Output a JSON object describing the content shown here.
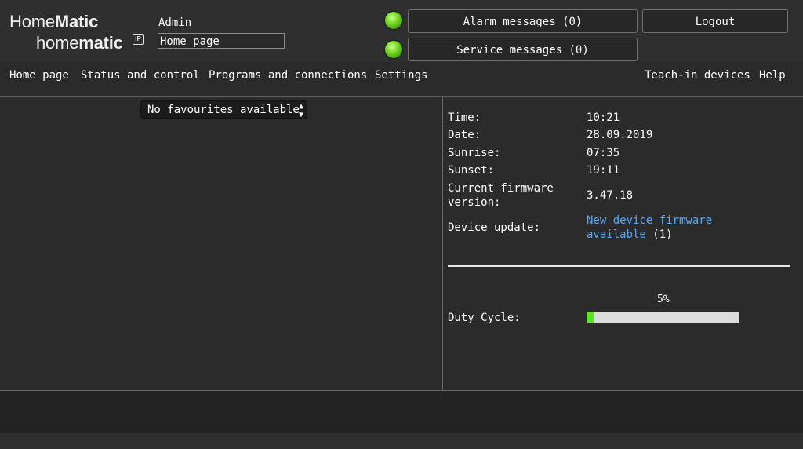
{
  "header": {
    "logo_line1_a": "Home",
    "logo_line1_b": "Matic",
    "logo_line2_a": "home",
    "logo_line2_b": "matic",
    "logo_badge": "IP",
    "user": "Admin",
    "current_page": "Home page",
    "alarm_label": "Alarm messages (0)",
    "service_label": "Service messages (0)",
    "logout_label": "Logout",
    "alarm_led_color": "#7ede2e",
    "service_led_color": "#7ede2e"
  },
  "nav": {
    "items": [
      "Home page",
      "Status and control",
      "Programs and connections",
      "Settings"
    ],
    "right_items": [
      "Teach-in devices",
      "Help"
    ]
  },
  "favourites": {
    "selected": "No favourites available"
  },
  "info": {
    "time_label": "Time:",
    "time_value": "10:21",
    "date_label": "Date:",
    "date_value": "28.09.2019",
    "sunrise_label": "Sunrise:",
    "sunrise_value": "07:35",
    "sunset_label": "Sunset:",
    "sunset_value": "19:11",
    "firmware_label_1": "Current firmware",
    "firmware_label_2": "version:",
    "firmware_value": "3.47.18",
    "update_label": "Device update:",
    "update_link_1": "New device firmware",
    "update_link_2": "available",
    "update_count": " (1)"
  },
  "duty_cycle": {
    "label": "Duty Cycle:",
    "percent_text": "5%",
    "fraction": 0.05,
    "fill_color": "#5fe028"
  }
}
